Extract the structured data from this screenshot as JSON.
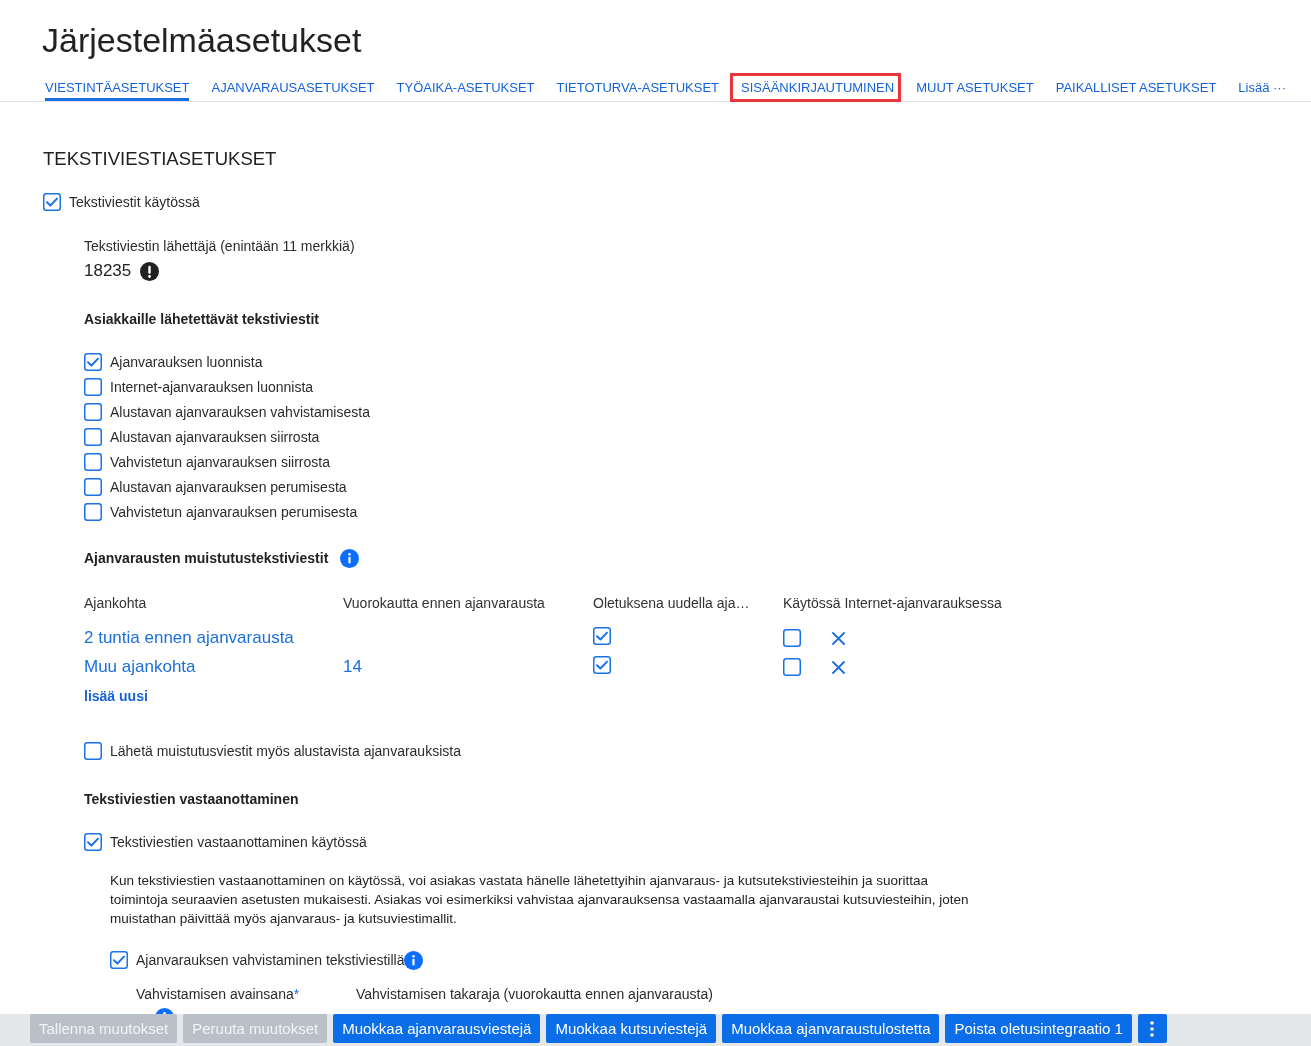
{
  "page": {
    "title": "Järjestelmäasetukset"
  },
  "tabs": [
    {
      "label": "VIESTINTÄASETUKSET",
      "selected": true,
      "highlighted": false
    },
    {
      "label": "AJANVARAUSASETUKSET",
      "selected": false,
      "highlighted": false
    },
    {
      "label": "TYÖAIKA-ASETUKSET",
      "selected": false,
      "highlighted": false
    },
    {
      "label": "TIETOTURVA-ASETUKSET",
      "selected": false,
      "highlighted": false
    },
    {
      "label": "SISÄÄNKIRJAUTUMINEN",
      "selected": false,
      "highlighted": true
    },
    {
      "label": "MUUT ASETUKSET",
      "selected": false,
      "highlighted": false
    },
    {
      "label": "PAIKALLISET ASETUKSET",
      "selected": false,
      "highlighted": false
    }
  ],
  "more_tabs": {
    "label": "Lisää ···"
  },
  "sms_settings": {
    "heading": "TEKSTIVIESTIASETUKSET",
    "enabled": {
      "label": "Tekstiviestit käytössä",
      "checked": true
    },
    "sender": {
      "label": "Tekstiviestin lähettäjä (enintään 11 merkkiä)",
      "value": "18235"
    },
    "customer_messages": {
      "heading": "Asiakkaille lähetettävät tekstiviestit",
      "options": [
        {
          "label": "Ajanvarauksen luonnista",
          "checked": true
        },
        {
          "label": "Internet-ajanvarauksen luonnista",
          "checked": false
        },
        {
          "label": "Alustavan ajanvarauksen vahvistamisesta",
          "checked": false
        },
        {
          "label": "Alustavan ajanvarauksen siirrosta",
          "checked": false
        },
        {
          "label": "Vahvistetun ajanvarauksen siirrosta",
          "checked": false
        },
        {
          "label": "Alustavan ajanvarauksen perumisesta",
          "checked": false
        },
        {
          "label": "Vahvistetun ajanvarauksen perumisesta",
          "checked": false
        }
      ]
    },
    "reminders": {
      "heading": "Ajanvarausten muistutustekstiviestit",
      "columns": [
        "Ajankohta",
        "Vuorokautta ennen ajanvarausta",
        "Oletuksena uudella aja…",
        "Käytössä Internet-ajanvarauksessa"
      ],
      "rows": [
        {
          "timing": "2 tuntia ennen ajanvarausta",
          "default_for_new": true,
          "internet_enabled": false
        },
        {
          "timing": "Muu ajankohta",
          "days": "14",
          "default_for_new": true,
          "internet_enabled": false
        }
      ],
      "add_link": "lisää uusi"
    },
    "send_preliminary": {
      "label": "Lähetä muistutusviestit myös alustavista ajanvarauksista",
      "checked": false
    }
  },
  "receiving": {
    "heading": "Tekstiviestien vastaanottaminen",
    "enabled": {
      "label": "Tekstiviestien vastaanottaminen käytössä",
      "checked": true
    },
    "description": "Kun tekstiviestien vastaanottaminen on käytössä, voi asiakas vastata hänelle lähetettyihin ajanvaraus- ja kutsutekstiviesteihin ja suorittaa toimintoja seuraavien asetusten mukaisesti. Asiakas voi esimerkiksi vahvistaa ajanvarauksensa vastaamalla ajanvaraustai kutsuviesteihin, joten muistathan päivittää myös ajanvaraus- ja kutsuviestimallit.",
    "confirmation": {
      "label": "Ajanvarauksen vahvistaminen tekstiviestillä",
      "checked": true
    },
    "keyword": {
      "label": "Vahvistamisen avainsana",
      "required_mark": "*"
    },
    "deadline": {
      "label": "Vahvistamisen takaraja (vuorokautta ennen ajanvarausta)"
    }
  },
  "footer": {
    "buttons": [
      {
        "label": "Tallenna muutokset",
        "disabled": true
      },
      {
        "label": "Peruuta muutokset",
        "disabled": true
      },
      {
        "label": "Muokkaa ajanvarausviestejä",
        "disabled": false
      },
      {
        "label": "Muokkaa kutsuviestejä",
        "disabled": false
      },
      {
        "label": "Muokkaa ajanvaraustulostetta",
        "disabled": false
      },
      {
        "label": "Poista oletusintegraatio 1",
        "disabled": false
      }
    ],
    "more_button": true
  }
}
